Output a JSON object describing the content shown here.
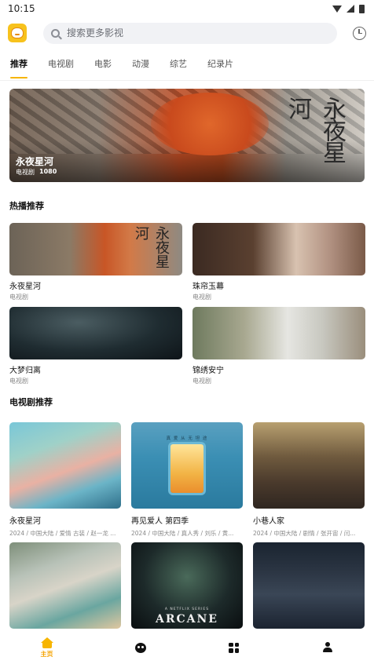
{
  "status_bar": {
    "time": "10:15"
  },
  "search": {
    "placeholder": "搜索更多影视"
  },
  "tabs": [
    {
      "label": "推荐",
      "active": true
    },
    {
      "label": "电视剧"
    },
    {
      "label": "电影"
    },
    {
      "label": "动漫"
    },
    {
      "label": "综艺"
    },
    {
      "label": "纪录片"
    }
  ],
  "banner": {
    "title": "永夜星河",
    "calligraphy": "永夜星河",
    "category": "电视剧",
    "resolution": "1080"
  },
  "hot": {
    "heading": "热播推荐",
    "items": [
      {
        "title": "永夜星河",
        "category": "电视剧",
        "calligraphy": "永夜星河"
      },
      {
        "title": "珠帘玉幕",
        "category": "电视剧"
      },
      {
        "title": "大梦归离",
        "category": "电视剧"
      },
      {
        "title": "锦绣安宁",
        "category": "电视剧"
      }
    ]
  },
  "tv": {
    "heading": "电视剧推荐",
    "items": [
      {
        "title": "永夜星河",
        "meta": "2024 / 中国大陆 / 爱情 古装 / 赵一龙 ..."
      },
      {
        "title": "再见爱人 第四季",
        "meta": "2024 / 中国大陆 / 真人秀 / 刘乐 / 黄...",
        "poster_text": "真 爱 从 无 坦 途"
      },
      {
        "title": "小巷人家",
        "meta": "2024 / 中国大陆 / 剧情 / 张开宙 / 闫..."
      },
      {
        "title": "",
        "meta": ""
      },
      {
        "title": "",
        "meta": "",
        "poster_text": "ARCANE",
        "poster_sub": "A NETFLIX SERIES"
      },
      {
        "title": "",
        "meta": ""
      }
    ]
  },
  "bottom_nav": {
    "home_label": "主页"
  },
  "colors": {
    "accent": "#f7b500"
  }
}
